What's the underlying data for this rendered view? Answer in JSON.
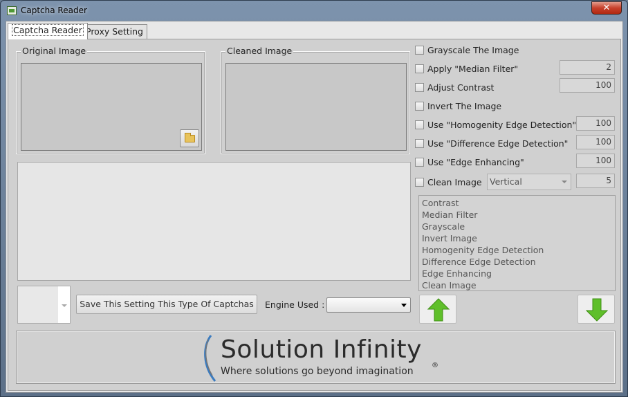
{
  "window": {
    "title": "Captcha Reader",
    "close_glyph": "✕"
  },
  "tabs": [
    {
      "label": "Captcha Reader",
      "active": true
    },
    {
      "label": "Proxy Setting",
      "active": false
    }
  ],
  "groups": {
    "original": "Original Image",
    "cleaned": "Cleaned Image"
  },
  "options": [
    {
      "label": "Grayscale The Image",
      "checked": false
    },
    {
      "label": "Apply \"Median Filter\"",
      "checked": false,
      "value": "2"
    },
    {
      "label": "Adjust Contrast",
      "checked": false,
      "value": "100"
    },
    {
      "label": "Invert The Image",
      "checked": false
    },
    {
      "label": "Use \"Homogenity Edge Detection\"",
      "checked": false,
      "value": "100"
    },
    {
      "label": "Use \"Difference Edge Detection\"",
      "checked": false,
      "value": "100"
    },
    {
      "label": "Use \"Edge Enhancing\"",
      "checked": false,
      "value": "100"
    },
    {
      "label": "Clean Image",
      "checked": false,
      "value": "5",
      "direction": "Vertical"
    }
  ],
  "filter_order": [
    "Contrast",
    "Median Filter",
    "Grayscale",
    "Invert Image",
    "Homogenity Edge Detection",
    "Difference Edge Detection",
    "Edge Enhancing",
    "Clean Image"
  ],
  "actions": {
    "save_label": "Save This Setting This Type Of Captchas",
    "engine_label": "Engine Used :",
    "engine_value": ""
  },
  "banner": {
    "brand": "Solution Infinity",
    "tagline": "Where solutions go beyond imagination",
    "reg": "®"
  },
  "colors": {
    "accent_green": "#5fbf2a",
    "brand_red": "#d9262b",
    "brand_blue": "#3b7bbf"
  },
  "icons": {
    "folder": "folder-icon",
    "up": "arrow-up-icon",
    "down": "arrow-down-icon"
  }
}
